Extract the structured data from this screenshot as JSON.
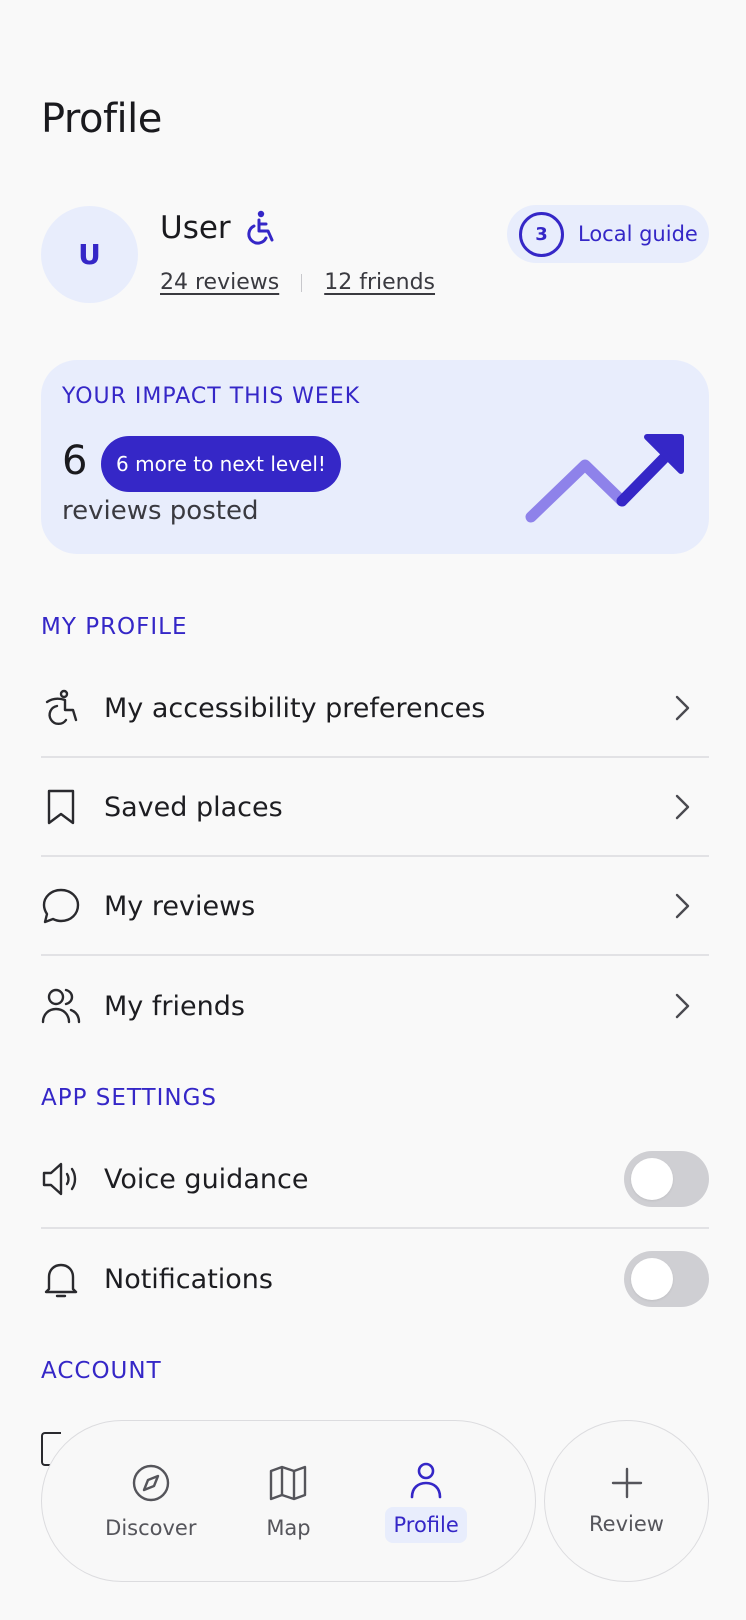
{
  "page": {
    "title": "Profile"
  },
  "user": {
    "avatar_initial": "U",
    "name": "User",
    "reviews_link": "24 reviews",
    "friends_link": "12 friends",
    "guide_level": "3",
    "guide_label": "Local guide"
  },
  "impact": {
    "title": "YOUR IMPACT THIS WEEK",
    "count": "6",
    "next_level_pill": "6 more to next level!",
    "subtitle": "reviews posted"
  },
  "my_profile": {
    "header": "MY PROFILE",
    "items": [
      {
        "label": "My accessibility preferences",
        "icon": "accessibility-icon"
      },
      {
        "label": "Saved places",
        "icon": "bookmark-icon"
      },
      {
        "label": "My reviews",
        "icon": "chat-bubble-icon"
      },
      {
        "label": "My friends",
        "icon": "users-icon"
      }
    ]
  },
  "app_settings": {
    "header": "APP SETTINGS",
    "items": [
      {
        "label": "Voice guidance",
        "icon": "speaker-icon",
        "enabled": false
      },
      {
        "label": "Notifications",
        "icon": "bell-icon",
        "enabled": false
      }
    ]
  },
  "account": {
    "header": "ACCOUNT"
  },
  "nav": {
    "items": [
      {
        "label": "Discover",
        "icon": "compass-icon",
        "active": false
      },
      {
        "label": "Map",
        "icon": "map-icon",
        "active": false
      },
      {
        "label": "Profile",
        "icon": "person-icon",
        "active": true
      }
    ],
    "review_label": "Review",
    "review_icon": "plus-icon"
  },
  "colors": {
    "accent": "#3527c7",
    "accent_soft": "#e8edfc",
    "background": "#f9f9f9",
    "toggle_off": "#cfcfd3"
  }
}
